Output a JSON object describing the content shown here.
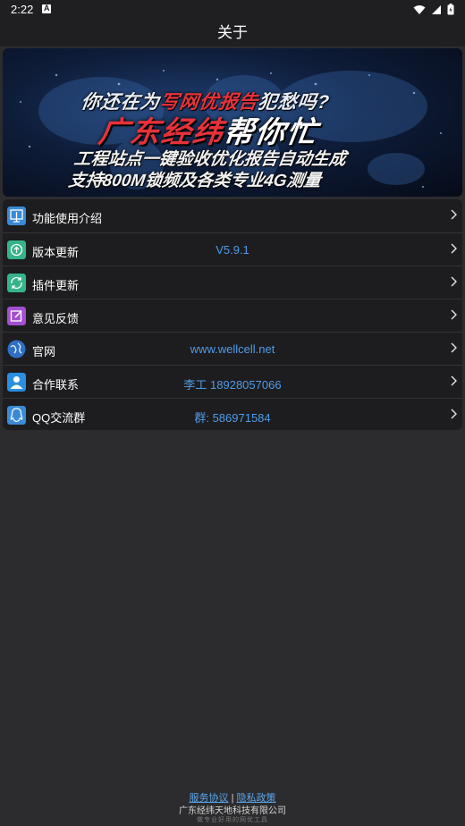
{
  "status_bar": {
    "time": "2:22"
  },
  "app_bar": {
    "title": "关于"
  },
  "banner": {
    "line1_prefix": "你还在为",
    "line1_highlight": "写网优报告",
    "line1_suffix": "犯愁吗?",
    "line2_main": "广东经纬",
    "line2_highlight": "帮你忙",
    "line3": "工程站点一键验收优化报告自动生成",
    "line4": "支持800M锁频及各类专业4G测量"
  },
  "menu": {
    "items": [
      {
        "label": "功能使用介绍",
        "value": "",
        "icon": "guide-icon",
        "color": "#3a8ad6"
      },
      {
        "label": "版本更新",
        "value": "V5.9.1",
        "icon": "update-icon",
        "color": "#35b48a"
      },
      {
        "label": "插件更新",
        "value": "",
        "icon": "plugin-update-icon",
        "color": "#35b48a"
      },
      {
        "label": "意见反馈",
        "value": "",
        "icon": "feedback-icon",
        "color": "#a24fd0"
      },
      {
        "label": "官网",
        "value": "www.wellcell.net",
        "icon": "globe-icon",
        "color": "#2f6fc6"
      },
      {
        "label": "合作联系",
        "value": "李工 18928057066",
        "icon": "contact-icon",
        "color": "#2a8fe0"
      },
      {
        "label": "QQ交流群",
        "value": "群: 586971584",
        "icon": "qq-icon",
        "color": "#3a8ad6"
      }
    ]
  },
  "footer": {
    "service_link": "服务协议",
    "separator": "|",
    "privacy_link": "隐私政策",
    "company": "广东经纬天地科技有限公司",
    "slogan": "做专业好用的网优工具"
  }
}
